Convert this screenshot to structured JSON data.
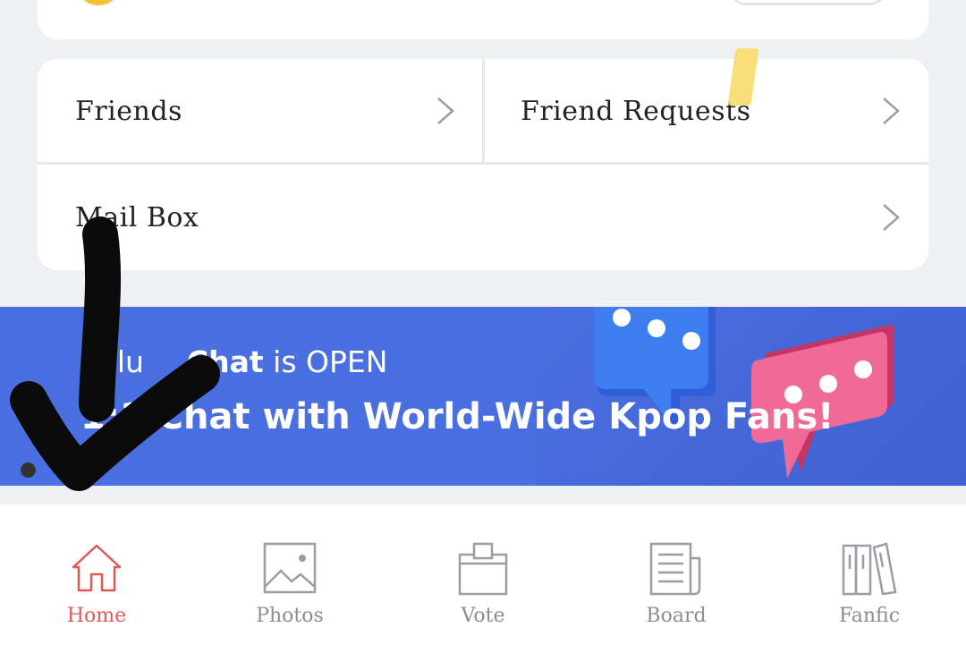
{
  "menu": {
    "friends_label": "Friends",
    "friend_requests_label": "Friend Requests",
    "mailbox_label": "Mail Box"
  },
  "banner": {
    "line1_prefix": "nPlu",
    "line1_bold": "Chat",
    "line1_suffix": " is OPEN",
    "line2": "1:1 Chat with World-Wide Kpop Fans!",
    "background_color": "#4a6fe0"
  },
  "tabbar": {
    "tabs": [
      {
        "label": "Home",
        "icon": "home-icon",
        "active": true
      },
      {
        "label": "Photos",
        "icon": "photos-icon",
        "active": false
      },
      {
        "label": "Vote",
        "icon": "vote-icon",
        "active": false
      },
      {
        "label": "Board",
        "icon": "board-icon",
        "active": false
      },
      {
        "label": "Fanfic",
        "icon": "fanfic-icon",
        "active": false
      }
    ],
    "active_color": "#e05a55",
    "inactive_color": "#8a8d92"
  },
  "annotations": {
    "checkmark_icon": "hand-drawn-checkmark",
    "highlight_mark": "yellow-highlight"
  }
}
